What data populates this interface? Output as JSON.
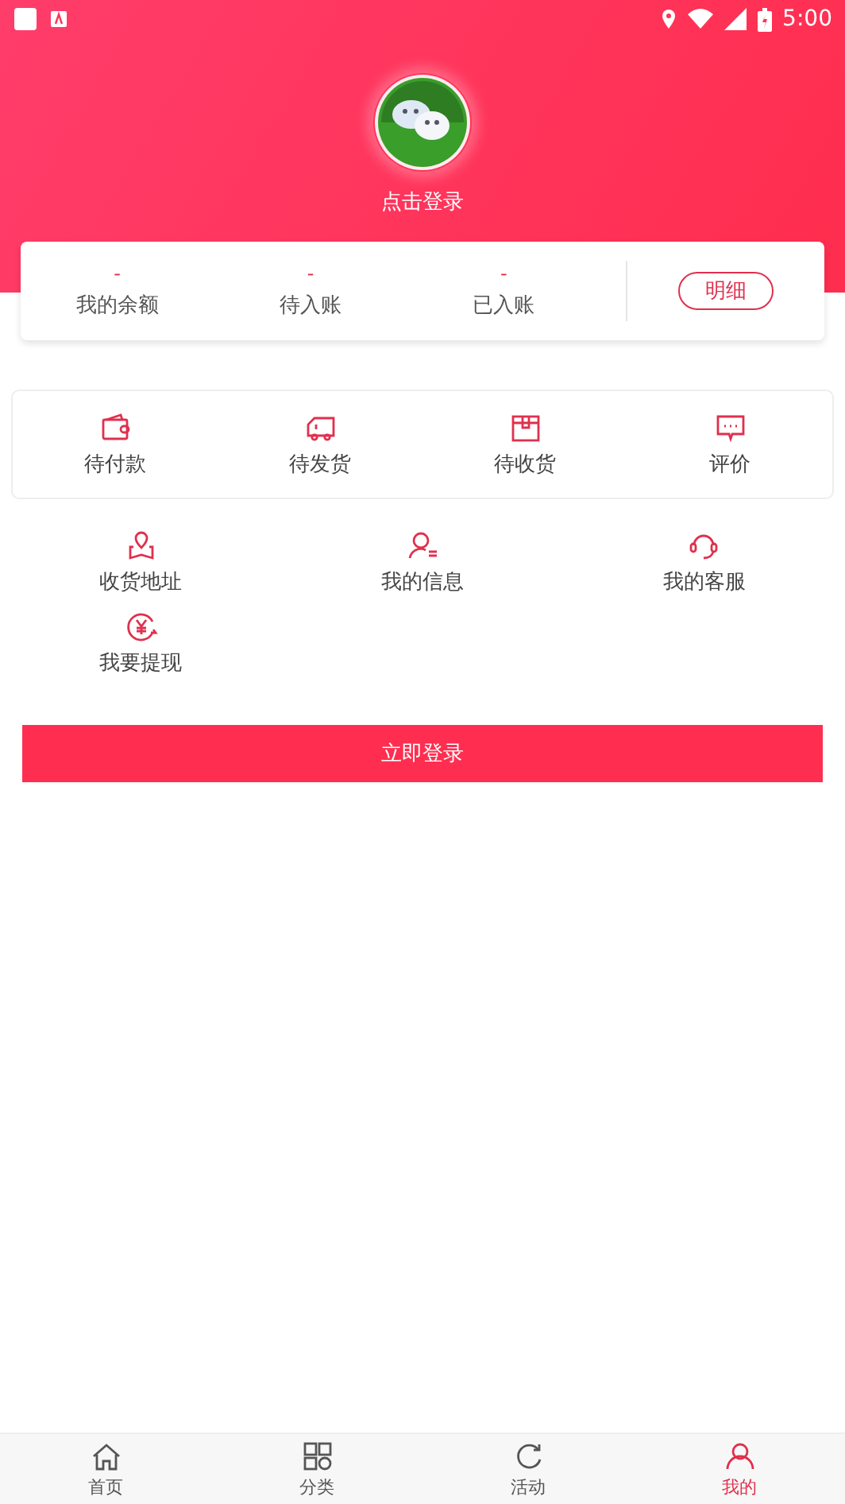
{
  "status_bar": {
    "time": "5:00"
  },
  "profile": {
    "login_text": "点击登录"
  },
  "balance": {
    "items": [
      {
        "value": "-",
        "label": "我的余额"
      },
      {
        "value": "-",
        "label": "待入账"
      },
      {
        "value": "-",
        "label": "已入账"
      }
    ],
    "detail_button": "明细"
  },
  "orders": [
    {
      "label": "待付款"
    },
    {
      "label": "待发货"
    },
    {
      "label": "待收货"
    },
    {
      "label": "评价"
    }
  ],
  "services": [
    {
      "label": "收货地址"
    },
    {
      "label": "我的信息"
    },
    {
      "label": "我的客服"
    },
    {
      "label": "我要提现"
    }
  ],
  "login_button": "立即登录",
  "tab_bar": [
    {
      "label": "首页",
      "selected": false
    },
    {
      "label": "分类",
      "selected": false
    },
    {
      "label": "活动",
      "selected": false
    },
    {
      "label": "我的",
      "selected": true
    }
  ]
}
